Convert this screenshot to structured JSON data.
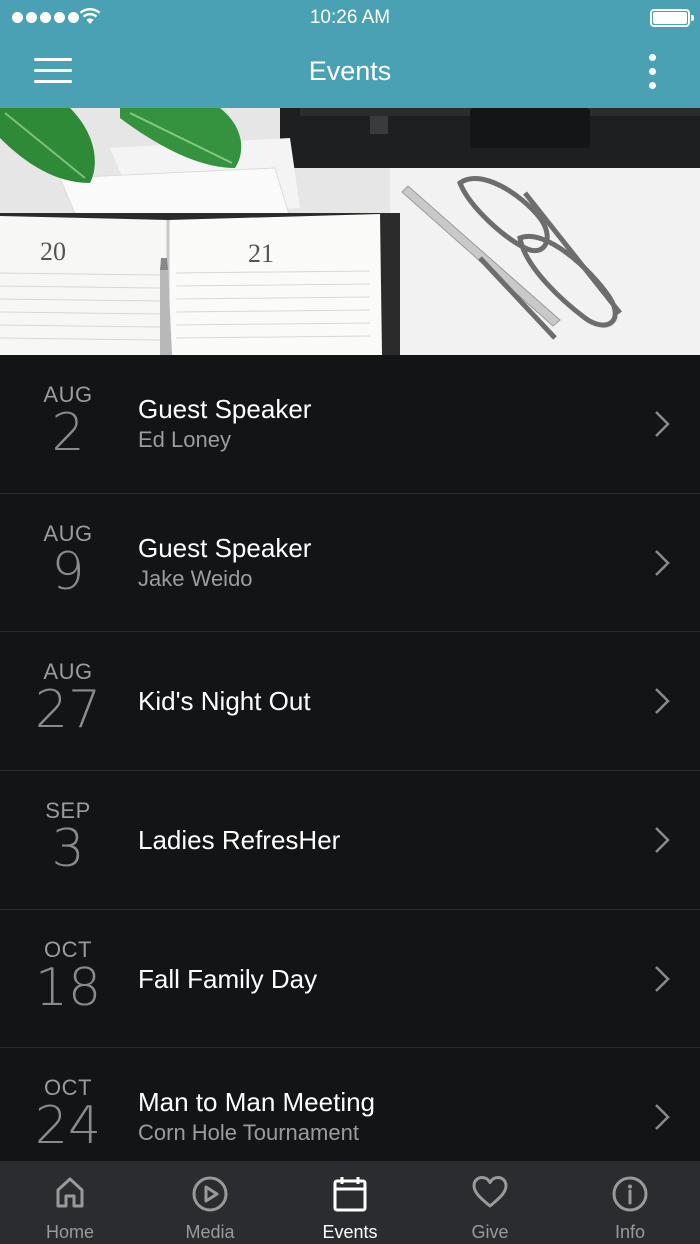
{
  "status_bar": {
    "time": "10:26 AM"
  },
  "nav": {
    "title": "Events"
  },
  "events": [
    {
      "month": "AUG",
      "day": "2",
      "title": "Guest Speaker",
      "subtitle": "Ed Loney"
    },
    {
      "month": "AUG",
      "day": "9",
      "title": "Guest Speaker",
      "subtitle": "Jake Weido"
    },
    {
      "month": "AUG",
      "day": "27",
      "title": "Kid's Night Out",
      "subtitle": ""
    },
    {
      "month": "SEP",
      "day": "3",
      "title": "Ladies RefresHer",
      "subtitle": ""
    },
    {
      "month": "OCT",
      "day": "18",
      "title": "Fall Family Day",
      "subtitle": ""
    },
    {
      "month": "OCT",
      "day": "24",
      "title": "Man to Man Meeting",
      "subtitle": "Corn Hole Tournament"
    }
  ],
  "tabs": [
    {
      "label": "Home",
      "icon": "home-icon"
    },
    {
      "label": "Media",
      "icon": "play-circle-icon"
    },
    {
      "label": "Events",
      "icon": "calendar-icon",
      "active": true
    },
    {
      "label": "Give",
      "icon": "heart-icon"
    },
    {
      "label": "Info",
      "icon": "info-circle-icon"
    }
  ],
  "hero_image": {
    "planner_left_page": "20",
    "planner_right_page": "21"
  },
  "colors": {
    "header": "#4aa1b4",
    "background": "#131416",
    "tabbar": "#2b2c2f",
    "divider": "#2a2b2e"
  }
}
